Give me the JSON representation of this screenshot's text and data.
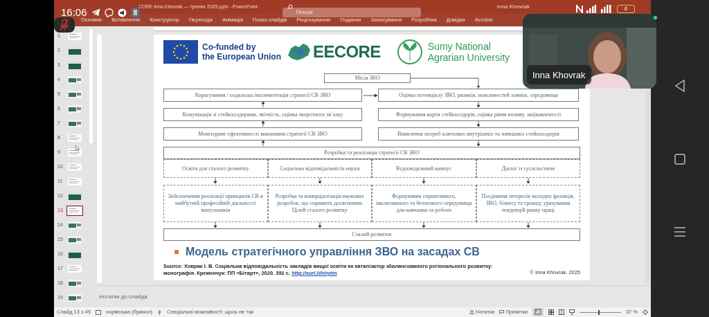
{
  "phone_status": {
    "time": "16:06",
    "battery": "6"
  },
  "window": {
    "title": "CORE Inna Khovrak — тренінг 2025.pptx - PowerPoint",
    "search": {
      "placeholder": "Пошук"
    },
    "user": "Inna Khovrak"
  },
  "ribbon_tabs": [
    "Основне",
    "Вставлення",
    "Конструктор",
    "Переходи",
    "Анімація",
    "Показ слайдів",
    "Рецензування",
    "Подання",
    "Записування",
    "Розробник",
    "Довідка",
    "Acrobat"
  ],
  "slides_panel": [
    {
      "number": "1",
      "kind": "light",
      "selected": false
    },
    {
      "number": "2",
      "kind": "dark",
      "selected": false
    },
    {
      "number": "3",
      "kind": "dark",
      "selected": false
    },
    {
      "number": "4",
      "kind": "mixed",
      "selected": false
    },
    {
      "number": "5",
      "kind": "mixed",
      "selected": false
    },
    {
      "number": "6",
      "kind": "mixed",
      "selected": false
    },
    {
      "number": "7",
      "kind": "mixed",
      "selected": false
    },
    {
      "number": "8",
      "kind": "light",
      "selected": false
    },
    {
      "number": "9",
      "kind": "light",
      "selected": false
    },
    {
      "number": "10",
      "kind": "light",
      "selected": false
    },
    {
      "number": "11",
      "kind": "light",
      "selected": false
    },
    {
      "number": "12",
      "kind": "dark",
      "selected": false
    },
    {
      "number": "13",
      "kind": "light",
      "selected": true
    },
    {
      "number": "14",
      "kind": "mixed",
      "selected": false
    },
    {
      "number": "15",
      "kind": "mixed",
      "selected": false
    },
    {
      "number": "16",
      "kind": "dark",
      "selected": false
    },
    {
      "number": "17",
      "kind": "light",
      "selected": false
    },
    {
      "number": "18",
      "kind": "mixed",
      "selected": false
    },
    {
      "number": "19",
      "kind": "mixed",
      "selected": false
    }
  ],
  "slide": {
    "logos": {
      "eu_lines": [
        "Co-funded by",
        "the European Union"
      ],
      "project": "EECORE",
      "university_lines": [
        "Sumy National",
        "Agrarian University"
      ]
    },
    "diagram": {
      "mission": "Місія ЗВО",
      "left_steps": [
        "Коригування / подальша імплементація стратегії СВ ЗВО",
        "Комунікація зі стейкхолдерами, звітність, оцінка зворотного зв`язку",
        "Моніторинг ефективності виконання стратегії СВ ЗВО"
      ],
      "right_steps": [
        "Оцінка потенціалу ЗВО, ризиків, можливостей зовніш. середовища",
        "Формування карти стейкхолдерів, оцінка рівня впливу, зацікавленості",
        "Виявлення потреб ключових внутрішніх та зовнішніх стейкхолдерів"
      ],
      "strategy": "Розробка  та реалізація стратегії СВ ЗВО",
      "directions": [
        "Освіта для сталого розвитку",
        "Соціальна відповідальність науки",
        "Відповідальний кампус",
        "Діалог із суспільством"
      ],
      "actions": [
        "Забезпечення реалізації принципів СВ в майбутній професійній діяльності випускників",
        "Розробка та комерціалізація наукових розробок, що сприяють досягненню Цілей сталого розвитку",
        "Формування сприятливого, інклюзивного та безпечного середовища для навчання та роботи",
        "Поєднання інтересів молодих фахівців, ЗВО, бізнесу та громад; урахування тенденцій ринку праці"
      ],
      "outcome": "Сталий розвиток"
    },
    "title": "Модель стратегічного управління ЗВО на засадах СВ",
    "source": "Source: Ховрак І. В. Соціальна відповідальність закладів вищої освіти як каталізатор збалансованого регіонального розвитку: монографія. Кременчук: ПП «Бітарт», 2020. 392 с.",
    "link": "http://surl.li/hhytm",
    "copyright": "© Inna Khovrak, 2025"
  },
  "notes": {
    "placeholder": "Нотатки до слайда"
  },
  "status_bar": {
    "slide_count": "Слайд 13 з 45",
    "language": "норвезька (букмол)",
    "accessibility": "Спеціальні можливості: щось не так",
    "notes_button": "Нотатки",
    "comments_button": "Примітки",
    "zoom_slider": {
      "level": 0.45
    },
    "zoom": "37 %"
  },
  "video": {
    "name": "Inna Khovrak"
  }
}
